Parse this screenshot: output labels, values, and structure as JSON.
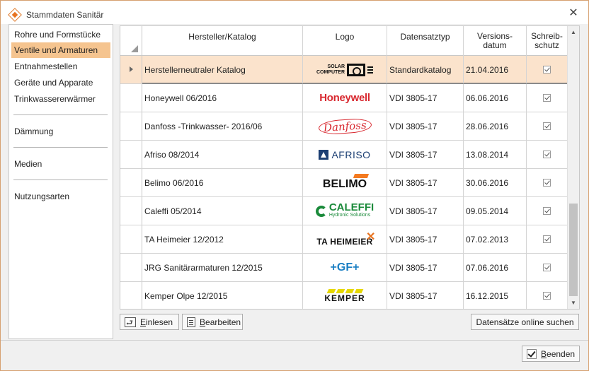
{
  "window": {
    "title": "Stammdaten Sanitär"
  },
  "nav": {
    "groups": [
      [
        "Rohre und Formstücke",
        "Ventile und Armaturen",
        "Entnahmestellen",
        "Geräte und Apparate",
        "Trinkwassererwärmer"
      ],
      [
        "Dämmung"
      ],
      [
        "Medien"
      ],
      [
        "Nutzungsarten"
      ]
    ],
    "selected": "Ventile und Armaturen"
  },
  "grid": {
    "columns": {
      "manufacturer": "Hersteller/Katalog",
      "logo": "Logo",
      "type": "Datensatztyp",
      "version_l1": "Versions-",
      "version_l2": "datum",
      "writeprot_l1": "Schreib-",
      "writeprot_l2": "schutz"
    },
    "rows": [
      {
        "name": "Herstellerneutraler Katalog",
        "logo": "solar-computer-logo",
        "type": "Standardkatalog",
        "date": "21.04.2016",
        "write_protected": true,
        "selected": true
      },
      {
        "name": "Honeywell 06/2016",
        "logo": "honeywell-logo",
        "type": "VDI 3805-17",
        "date": "06.06.2016",
        "write_protected": true
      },
      {
        "name": "Danfoss -Trinkwasser- 2016/06",
        "logo": "danfoss-logo",
        "type": "VDI 3805-17",
        "date": "28.06.2016",
        "write_protected": true
      },
      {
        "name": "Afriso 08/2014",
        "logo": "afriso-logo",
        "type": "VDI 3805-17",
        "date": "13.08.2014",
        "write_protected": true
      },
      {
        "name": "Belimo 06/2016",
        "logo": "belimo-logo",
        "type": "VDI 3805-17",
        "date": "30.06.2016",
        "write_protected": true
      },
      {
        "name": "Caleffi 05/2014",
        "logo": "caleffi-logo",
        "type": "VDI 3805-17",
        "date": "09.05.2014",
        "write_protected": true
      },
      {
        "name": "TA Heimeier 12/2012",
        "logo": "ta-heimeier-logo",
        "type": "VDI 3805-17",
        "date": "07.02.2013",
        "write_protected": true
      },
      {
        "name": "JRG Sanitärarmaturen 12/2015",
        "logo": "gf-logo",
        "type": "VDI 3805-17",
        "date": "07.06.2016",
        "write_protected": true
      },
      {
        "name": "Kemper Olpe 12/2015",
        "logo": "kemper-logo",
        "type": "VDI 3805-17",
        "date": "16.12.2015",
        "write_protected": true
      }
    ]
  },
  "logos": {
    "solar_l1": "SOLAR",
    "solar_l2": "COMPUTER",
    "honeywell": "Honeywell",
    "danfoss": "Danfoss",
    "afriso": "AFRISO",
    "belimo": "BELIMO",
    "caleffi": "CALEFFI",
    "caleffi_sub": "Hydronic Solutions",
    "heimeier": "TA HEIMEIER",
    "gf": "+GF+",
    "kemper": "KEMPER"
  },
  "buttons": {
    "import_first": "E",
    "import_rest": "inlesen",
    "edit_first": "B",
    "edit_rest": "earbeiten",
    "online": "Datensätze online suchen",
    "finish_first": "B",
    "finish_rest": "eenden"
  },
  "colors": {
    "accent": "#f5c48f",
    "selected_row": "#fbe3cc",
    "window_border": "#d6a070"
  }
}
